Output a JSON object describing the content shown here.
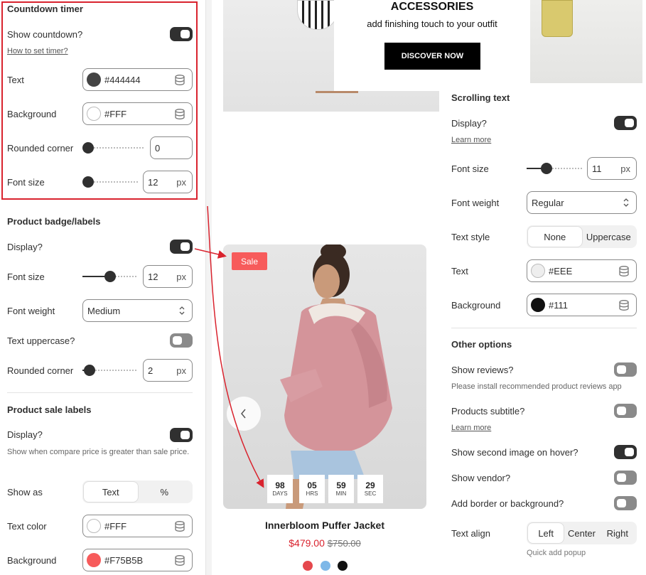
{
  "left": {
    "countdown": {
      "title": "Countdown timer",
      "show_label": "Show countdown?",
      "help_link": "How to set timer?",
      "text_label": "Text",
      "text_value": "#444444",
      "text_color": "#444444",
      "bg_label": "Background",
      "bg_value": "#FFF",
      "bg_color": "#FFFFFF",
      "rounded_label": "Rounded corner",
      "rounded_value": "0",
      "font_size_label": "Font size",
      "font_size_value": "12",
      "unit": "px"
    },
    "badge": {
      "title": "Product badge/labels",
      "display_label": "Display?",
      "font_size_label": "Font size",
      "font_size_value": "12",
      "unit": "px",
      "font_weight_label": "Font weight",
      "font_weight_value": "Medium",
      "uppercase_label": "Text uppercase?",
      "rounded_label": "Rounded corner",
      "rounded_value": "2"
    },
    "sale": {
      "title": "Product sale labels",
      "display_label": "Display?",
      "display_help": "Show when compare price is greater than sale price.",
      "show_as_label": "Show as",
      "show_as_options": [
        "Text",
        "%"
      ],
      "text_color_label": "Text color",
      "text_color_value": "#FFF",
      "text_color_swatch": "#FFFFFF",
      "bg_label": "Background",
      "bg_value": "#F75B5B",
      "bg_swatch": "#F75B5B"
    }
  },
  "preview": {
    "banner_title": "ACCESSORIES",
    "banner_subtitle": "add finishing touch to your outfit",
    "banner_button": "DISCOVER NOW",
    "sale_badge": "Sale",
    "countdown": [
      {
        "num": "98",
        "lbl": "DAYS"
      },
      {
        "num": "05",
        "lbl": "HRS"
      },
      {
        "num": "59",
        "lbl": "MIN"
      },
      {
        "num": "29",
        "lbl": "SEC"
      }
    ],
    "product_name": "Innerbloom Puffer Jacket",
    "price": "$479.00",
    "compare_price": "$750.00",
    "swatches": [
      "#E5484D",
      "#7EB8E8",
      "#111111"
    ]
  },
  "right": {
    "scrolling": {
      "title": "Scrolling text",
      "display_label": "Display?",
      "learn_more": "Learn more",
      "font_size_label": "Font size",
      "font_size_value": "11",
      "unit": "px",
      "font_weight_label": "Font weight",
      "font_weight_value": "Regular",
      "text_style_label": "Text style",
      "text_style_options": [
        "None",
        "Uppercase"
      ],
      "text_label": "Text",
      "text_value": "#EEE",
      "text_swatch": "#EEEEEE",
      "bg_label": "Background",
      "bg_value": "#111",
      "bg_swatch": "#111111"
    },
    "other": {
      "title": "Other options",
      "reviews_label": "Show reviews?",
      "reviews_help": "Please install recommended product reviews app",
      "subtitle_label": "Products subtitle?",
      "learn_more": "Learn more",
      "second_image_label": "Show second image on hover?",
      "vendor_label": "Show vendor?",
      "border_label": "Add border or background?",
      "align_label": "Text align",
      "align_options": [
        "Left",
        "Center",
        "Right"
      ],
      "quick_add": "Quick add popup"
    }
  }
}
